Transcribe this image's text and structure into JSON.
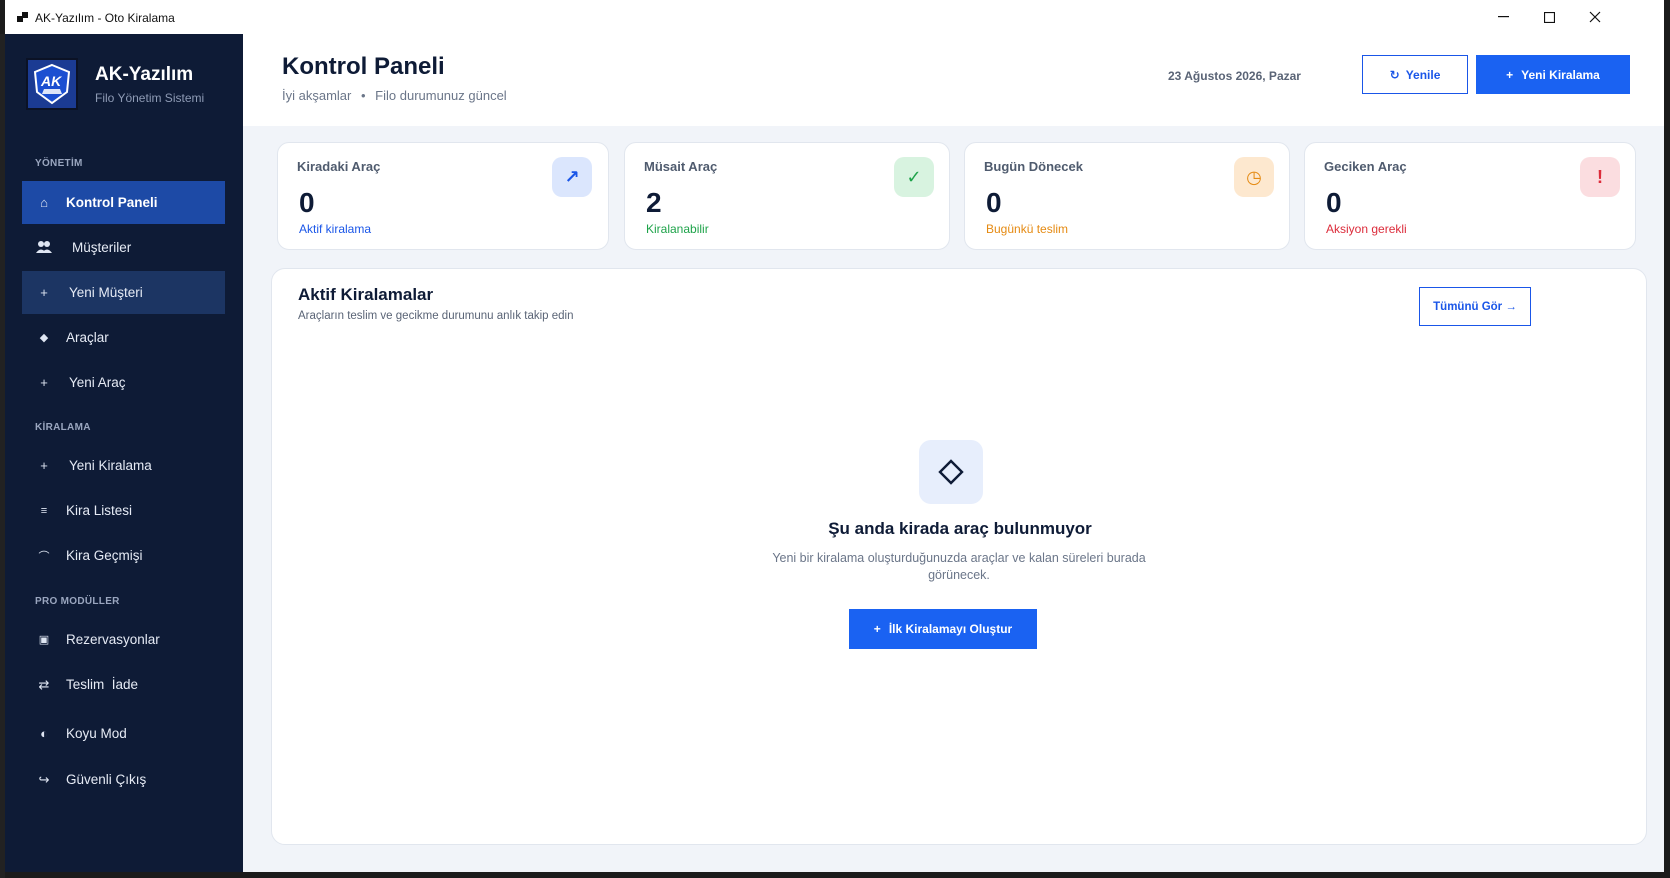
{
  "window": {
    "title": "AK-Yazılım - Oto Kiralama"
  },
  "brand": {
    "name": "AK-Yazılım",
    "subtitle": "Filo Yönetim Sistemi",
    "logo_text": "AK"
  },
  "sidebar": {
    "sections": [
      {
        "label": "YÖNETİM"
      },
      {
        "label": "KİRALAMA"
      },
      {
        "label": "PRO MODÜLLER"
      }
    ],
    "items": [
      {
        "label": "Kontrol Paneli",
        "icon": "home-icon",
        "glyph": "⌂",
        "active": true
      },
      {
        "label": "Müşteriler",
        "icon": "users-icon",
        "glyph": "👥"
      },
      {
        "label": "Yeni Müşteri",
        "icon": "plus-icon",
        "glyph": "+"
      },
      {
        "label": "Araçlar",
        "icon": "diamond-icon",
        "glyph": "◆"
      },
      {
        "label": "Yeni Araç",
        "icon": "plus-icon",
        "glyph": "+"
      },
      {
        "label": "Yeni Kiralama",
        "icon": "plus-icon",
        "glyph": "+"
      },
      {
        "label": "Kira Listesi",
        "icon": "list-icon",
        "glyph": "≡"
      },
      {
        "label": "Kira Geçmişi",
        "icon": "history-icon",
        "glyph": "⌒"
      },
      {
        "label": "Rezervasyonlar",
        "icon": "calendar-icon",
        "glyph": "▣"
      },
      {
        "label": "Teslim  İade",
        "icon": "swap-icon",
        "glyph": "⇄"
      },
      {
        "label": "Koyu Mod",
        "icon": "moon-icon",
        "glyph": "◐"
      },
      {
        "label": "Güvenli Çıkış",
        "icon": "logout-icon",
        "glyph": "↪"
      }
    ]
  },
  "header": {
    "title": "Kontrol Paneli",
    "greeting": "İyi akşamlar",
    "status": "Filo durumunuz güncel",
    "date": "23 Ağustos 2026, Pazar",
    "refresh_label": "Yenile",
    "refresh_glyph": "↻",
    "new_rental_label": "Yeni Kiralama",
    "new_rental_glyph": "+"
  },
  "stats": [
    {
      "label": "Kiradaki Araç",
      "value": "0",
      "note": "Aktif kiralama",
      "glyph": "↗",
      "color": "#1a56e8",
      "icon_bg": "#dbe6fd"
    },
    {
      "label": "Müsait Araç",
      "value": "2",
      "note": "Kiralanabilir",
      "glyph": "✓",
      "color": "#1ea34a",
      "icon_bg": "#d8f3e0"
    },
    {
      "label": "Bugün Dönecek",
      "value": "0",
      "note": "Bugünkü teslim",
      "glyph": "◷",
      "color": "#e58a12",
      "icon_bg": "#fde8cf"
    },
    {
      "label": "Geciken Araç",
      "value": "0",
      "note": "Aksiyon gerekli",
      "glyph": "!",
      "color": "#dc2c3b",
      "icon_bg": "#fbdde0"
    }
  ],
  "active_rentals": {
    "title": "Aktif Kiralamalar",
    "subtitle": "Araçların teslim ve gecikme durumunu anlık takip edin",
    "view_all_label": "Tümünü Gör →",
    "empty_glyph": "◇",
    "empty_title": "Şu anda kirada araç bulunmuyor",
    "empty_description": "Yeni bir kiralama oluşturduğunuzda araçlar ve kalan süreleri burada görünecek.",
    "cta_label": "İlk Kiralamayı Oluştur",
    "cta_glyph": "+"
  },
  "colors": {
    "sidebar_bg": "#0e1b36",
    "accent": "#1a62f2",
    "active_nav": "#1d4aa6"
  }
}
